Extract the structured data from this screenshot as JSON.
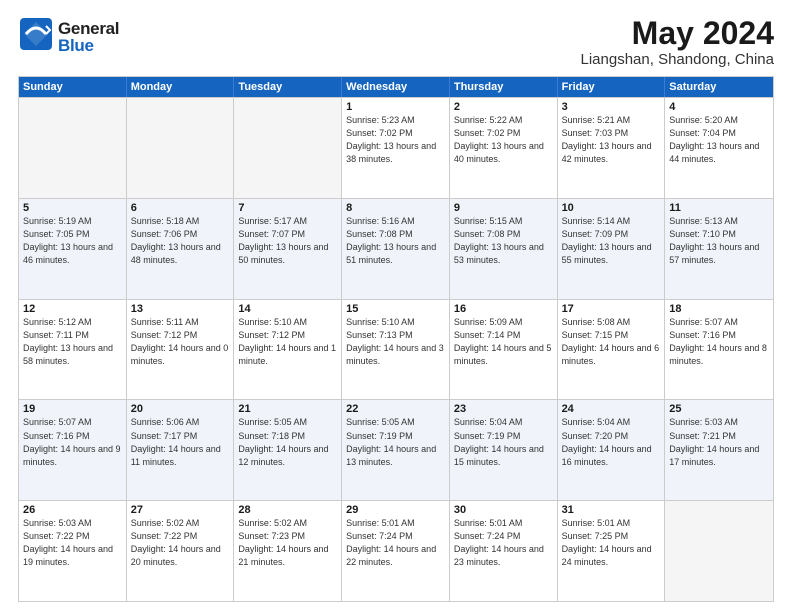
{
  "header": {
    "logo_general": "General",
    "logo_blue": "Blue",
    "title": "May 2024",
    "location": "Liangshan, Shandong, China"
  },
  "days_of_week": [
    "Sunday",
    "Monday",
    "Tuesday",
    "Wednesday",
    "Thursday",
    "Friday",
    "Saturday"
  ],
  "weeks": [
    {
      "alt": false,
      "cells": [
        {
          "day": "",
          "empty": true
        },
        {
          "day": "",
          "empty": true
        },
        {
          "day": "",
          "empty": true
        },
        {
          "day": "1",
          "sunrise": "Sunrise: 5:23 AM",
          "sunset": "Sunset: 7:02 PM",
          "daylight": "Daylight: 13 hours and 38 minutes."
        },
        {
          "day": "2",
          "sunrise": "Sunrise: 5:22 AM",
          "sunset": "Sunset: 7:02 PM",
          "daylight": "Daylight: 13 hours and 40 minutes."
        },
        {
          "day": "3",
          "sunrise": "Sunrise: 5:21 AM",
          "sunset": "Sunset: 7:03 PM",
          "daylight": "Daylight: 13 hours and 42 minutes."
        },
        {
          "day": "4",
          "sunrise": "Sunrise: 5:20 AM",
          "sunset": "Sunset: 7:04 PM",
          "daylight": "Daylight: 13 hours and 44 minutes."
        }
      ]
    },
    {
      "alt": true,
      "cells": [
        {
          "day": "5",
          "sunrise": "Sunrise: 5:19 AM",
          "sunset": "Sunset: 7:05 PM",
          "daylight": "Daylight: 13 hours and 46 minutes."
        },
        {
          "day": "6",
          "sunrise": "Sunrise: 5:18 AM",
          "sunset": "Sunset: 7:06 PM",
          "daylight": "Daylight: 13 hours and 48 minutes."
        },
        {
          "day": "7",
          "sunrise": "Sunrise: 5:17 AM",
          "sunset": "Sunset: 7:07 PM",
          "daylight": "Daylight: 13 hours and 50 minutes."
        },
        {
          "day": "8",
          "sunrise": "Sunrise: 5:16 AM",
          "sunset": "Sunset: 7:08 PM",
          "daylight": "Daylight: 13 hours and 51 minutes."
        },
        {
          "day": "9",
          "sunrise": "Sunrise: 5:15 AM",
          "sunset": "Sunset: 7:08 PM",
          "daylight": "Daylight: 13 hours and 53 minutes."
        },
        {
          "day": "10",
          "sunrise": "Sunrise: 5:14 AM",
          "sunset": "Sunset: 7:09 PM",
          "daylight": "Daylight: 13 hours and 55 minutes."
        },
        {
          "day": "11",
          "sunrise": "Sunrise: 5:13 AM",
          "sunset": "Sunset: 7:10 PM",
          "daylight": "Daylight: 13 hours and 57 minutes."
        }
      ]
    },
    {
      "alt": false,
      "cells": [
        {
          "day": "12",
          "sunrise": "Sunrise: 5:12 AM",
          "sunset": "Sunset: 7:11 PM",
          "daylight": "Daylight: 13 hours and 58 minutes."
        },
        {
          "day": "13",
          "sunrise": "Sunrise: 5:11 AM",
          "sunset": "Sunset: 7:12 PM",
          "daylight": "Daylight: 14 hours and 0 minutes."
        },
        {
          "day": "14",
          "sunrise": "Sunrise: 5:10 AM",
          "sunset": "Sunset: 7:12 PM",
          "daylight": "Daylight: 14 hours and 1 minute."
        },
        {
          "day": "15",
          "sunrise": "Sunrise: 5:10 AM",
          "sunset": "Sunset: 7:13 PM",
          "daylight": "Daylight: 14 hours and 3 minutes."
        },
        {
          "day": "16",
          "sunrise": "Sunrise: 5:09 AM",
          "sunset": "Sunset: 7:14 PM",
          "daylight": "Daylight: 14 hours and 5 minutes."
        },
        {
          "day": "17",
          "sunrise": "Sunrise: 5:08 AM",
          "sunset": "Sunset: 7:15 PM",
          "daylight": "Daylight: 14 hours and 6 minutes."
        },
        {
          "day": "18",
          "sunrise": "Sunrise: 5:07 AM",
          "sunset": "Sunset: 7:16 PM",
          "daylight": "Daylight: 14 hours and 8 minutes."
        }
      ]
    },
    {
      "alt": true,
      "cells": [
        {
          "day": "19",
          "sunrise": "Sunrise: 5:07 AM",
          "sunset": "Sunset: 7:16 PM",
          "daylight": "Daylight: 14 hours and 9 minutes."
        },
        {
          "day": "20",
          "sunrise": "Sunrise: 5:06 AM",
          "sunset": "Sunset: 7:17 PM",
          "daylight": "Daylight: 14 hours and 11 minutes."
        },
        {
          "day": "21",
          "sunrise": "Sunrise: 5:05 AM",
          "sunset": "Sunset: 7:18 PM",
          "daylight": "Daylight: 14 hours and 12 minutes."
        },
        {
          "day": "22",
          "sunrise": "Sunrise: 5:05 AM",
          "sunset": "Sunset: 7:19 PM",
          "daylight": "Daylight: 14 hours and 13 minutes."
        },
        {
          "day": "23",
          "sunrise": "Sunrise: 5:04 AM",
          "sunset": "Sunset: 7:19 PM",
          "daylight": "Daylight: 14 hours and 15 minutes."
        },
        {
          "day": "24",
          "sunrise": "Sunrise: 5:04 AM",
          "sunset": "Sunset: 7:20 PM",
          "daylight": "Daylight: 14 hours and 16 minutes."
        },
        {
          "day": "25",
          "sunrise": "Sunrise: 5:03 AM",
          "sunset": "Sunset: 7:21 PM",
          "daylight": "Daylight: 14 hours and 17 minutes."
        }
      ]
    },
    {
      "alt": false,
      "cells": [
        {
          "day": "26",
          "sunrise": "Sunrise: 5:03 AM",
          "sunset": "Sunset: 7:22 PM",
          "daylight": "Daylight: 14 hours and 19 minutes."
        },
        {
          "day": "27",
          "sunrise": "Sunrise: 5:02 AM",
          "sunset": "Sunset: 7:22 PM",
          "daylight": "Daylight: 14 hours and 20 minutes."
        },
        {
          "day": "28",
          "sunrise": "Sunrise: 5:02 AM",
          "sunset": "Sunset: 7:23 PM",
          "daylight": "Daylight: 14 hours and 21 minutes."
        },
        {
          "day": "29",
          "sunrise": "Sunrise: 5:01 AM",
          "sunset": "Sunset: 7:24 PM",
          "daylight": "Daylight: 14 hours and 22 minutes."
        },
        {
          "day": "30",
          "sunrise": "Sunrise: 5:01 AM",
          "sunset": "Sunset: 7:24 PM",
          "daylight": "Daylight: 14 hours and 23 minutes."
        },
        {
          "day": "31",
          "sunrise": "Sunrise: 5:01 AM",
          "sunset": "Sunset: 7:25 PM",
          "daylight": "Daylight: 14 hours and 24 minutes."
        },
        {
          "day": "",
          "empty": true
        }
      ]
    }
  ]
}
